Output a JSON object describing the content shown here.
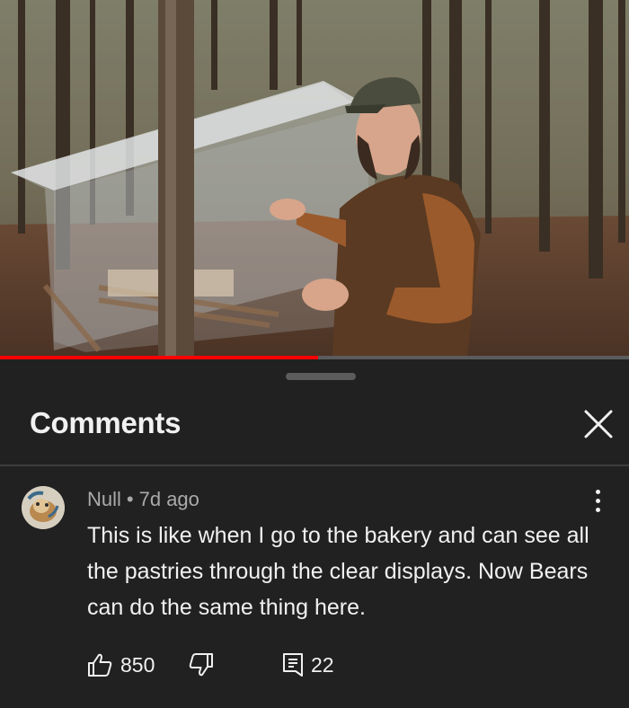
{
  "video": {
    "description_icon": "video-thumbnail",
    "progress_fraction": 0.505,
    "progress_color": "#ff0000"
  },
  "comments_panel": {
    "title": "Comments",
    "close_icon": "close-icon"
  },
  "comment": {
    "author": "Null",
    "separator": "•",
    "age": "7d ago",
    "text": "This is like when I go to the bakery and can see all the pastries through the clear displays. Now Bears can do the same thing here.",
    "likes": "850",
    "replies": "22",
    "icons": [
      "thumbs-up-icon",
      "thumbs-down-icon",
      "reply-icon",
      "more-vert-icon"
    ]
  }
}
